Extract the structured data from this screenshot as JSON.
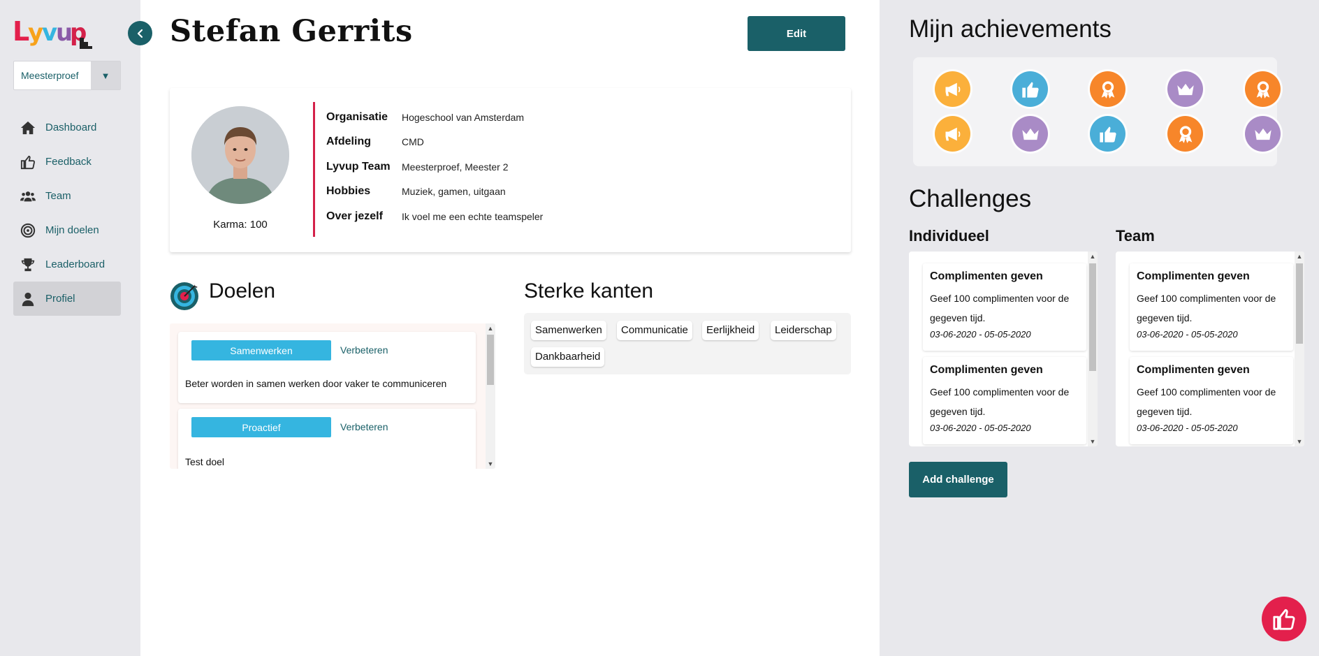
{
  "app": {
    "logo_text": "Lyvup"
  },
  "sidebar": {
    "team_select": {
      "value": "Meesterproef"
    },
    "items": [
      {
        "label": "Dashboard",
        "icon": "home-icon"
      },
      {
        "label": "Feedback",
        "icon": "thumbs-up-icon"
      },
      {
        "label": "Team",
        "icon": "users-icon"
      },
      {
        "label": "Mijn doelen",
        "icon": "target-icon"
      },
      {
        "label": "Leaderboard",
        "icon": "trophy-icon"
      },
      {
        "label": "Profiel",
        "icon": "user-icon",
        "active": true
      }
    ]
  },
  "header": {
    "title": "Stefan Gerrits",
    "edit_label": "Edit"
  },
  "profile": {
    "karma": "Karma: 100",
    "fields": [
      {
        "label": "Organisatie",
        "value": "Hogeschool van Amsterdam"
      },
      {
        "label": "Afdeling",
        "value": "CMD"
      },
      {
        "label": "Lyvup Team",
        "value": "Meesterproef, Meester 2"
      },
      {
        "label": "Hobbies",
        "value": "Muziek, gamen, uitgaan"
      },
      {
        "label": "Over jezelf",
        "value": "Ik voel me een echte teamspeler"
      }
    ]
  },
  "goals": {
    "title": "Doelen",
    "items": [
      {
        "tag": "Samenwerken",
        "link": "Verbeteren",
        "text": "Beter worden in samen werken door vaker te communiceren"
      },
      {
        "tag": "Proactief",
        "link": "Verbeteren",
        "text": "Test doel"
      }
    ]
  },
  "strengths": {
    "title": "Sterke kanten",
    "items": [
      "Samenwerken",
      "Communicatie",
      "Eerlijkheid",
      "Leiderschap",
      "Dankbaarheid"
    ]
  },
  "achievements": {
    "title": "Mijn achievements",
    "badges": [
      {
        "icon": "megaphone-icon",
        "color": "#fbb03b"
      },
      {
        "icon": "thumbs-up-icon",
        "color": "#4aaed8"
      },
      {
        "icon": "medal-icon",
        "color": "#f7862a"
      },
      {
        "icon": "crown-icon",
        "color": "#a98bc6"
      },
      {
        "icon": "medal-icon",
        "color": "#f7862a"
      },
      {
        "icon": "megaphone-icon",
        "color": "#fbb03b"
      },
      {
        "icon": "crown-icon",
        "color": "#a98bc6"
      },
      {
        "icon": "thumbs-up-icon",
        "color": "#4aaed8"
      },
      {
        "icon": "medal-icon",
        "color": "#f7862a"
      },
      {
        "icon": "crown-icon",
        "color": "#a98bc6"
      }
    ]
  },
  "challenges": {
    "title": "Challenges",
    "individual": {
      "title": "Individueel",
      "items": [
        {
          "title": "Complimenten geven",
          "desc": "Geef 100 complimenten voor de gegeven tijd.",
          "date": "03-06-2020 - 05-05-2020"
        },
        {
          "title": "Complimenten geven",
          "desc": "Geef 100 complimenten voor de gegeven tijd.",
          "date": "03-06-2020 - 05-05-2020"
        }
      ]
    },
    "team": {
      "title": "Team",
      "items": [
        {
          "title": "Complimenten geven",
          "desc": "Geef 100 complimenten voor de gegeven tijd.",
          "date": "03-06-2020 - 05-05-2020"
        },
        {
          "title": "Complimenten geven",
          "desc": "Geef 100 complimenten voor de gegeven tijd.",
          "date": "03-06-2020 - 05-05-2020"
        }
      ]
    },
    "add_label": "Add challenge"
  },
  "colors": {
    "primary": "#1a6068",
    "accent": "#e3204c",
    "tag": "#35b5e0"
  }
}
